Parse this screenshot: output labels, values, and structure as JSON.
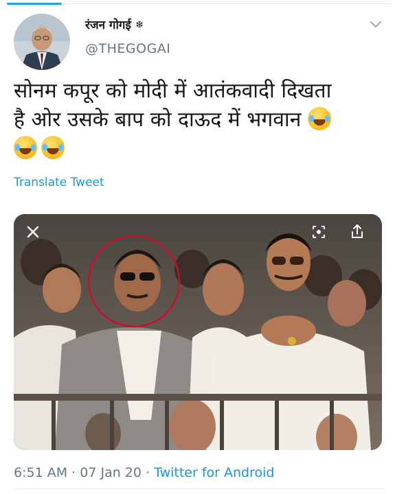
{
  "tweet": {
    "author_name": "रंजन गोगई",
    "author_badge_icon": "snowflake-badge-icon",
    "handle": "@THEGOGAI",
    "text_line1": "सोनम कपूर को मोदी में आतंकवादी दिखता",
    "text_line2": "है ओर उसके बाप को दाऊद में भगवान",
    "emoji_icon": "face-with-tears-of-joy-icon",
    "translate_label": "Translate Tweet",
    "time": "6:51 AM",
    "separator": "·",
    "date": "07 Jan 20",
    "client": "Twitter for Android"
  },
  "photo": {
    "close_icon": "close-icon",
    "lens_icon": "lens-icon",
    "share_icon": "share-icon",
    "highlight_color": "#c8102e"
  },
  "colors": {
    "accent": "#1da1f2",
    "link": "#1b95e0",
    "muted": "#657786",
    "text": "#14171a"
  }
}
